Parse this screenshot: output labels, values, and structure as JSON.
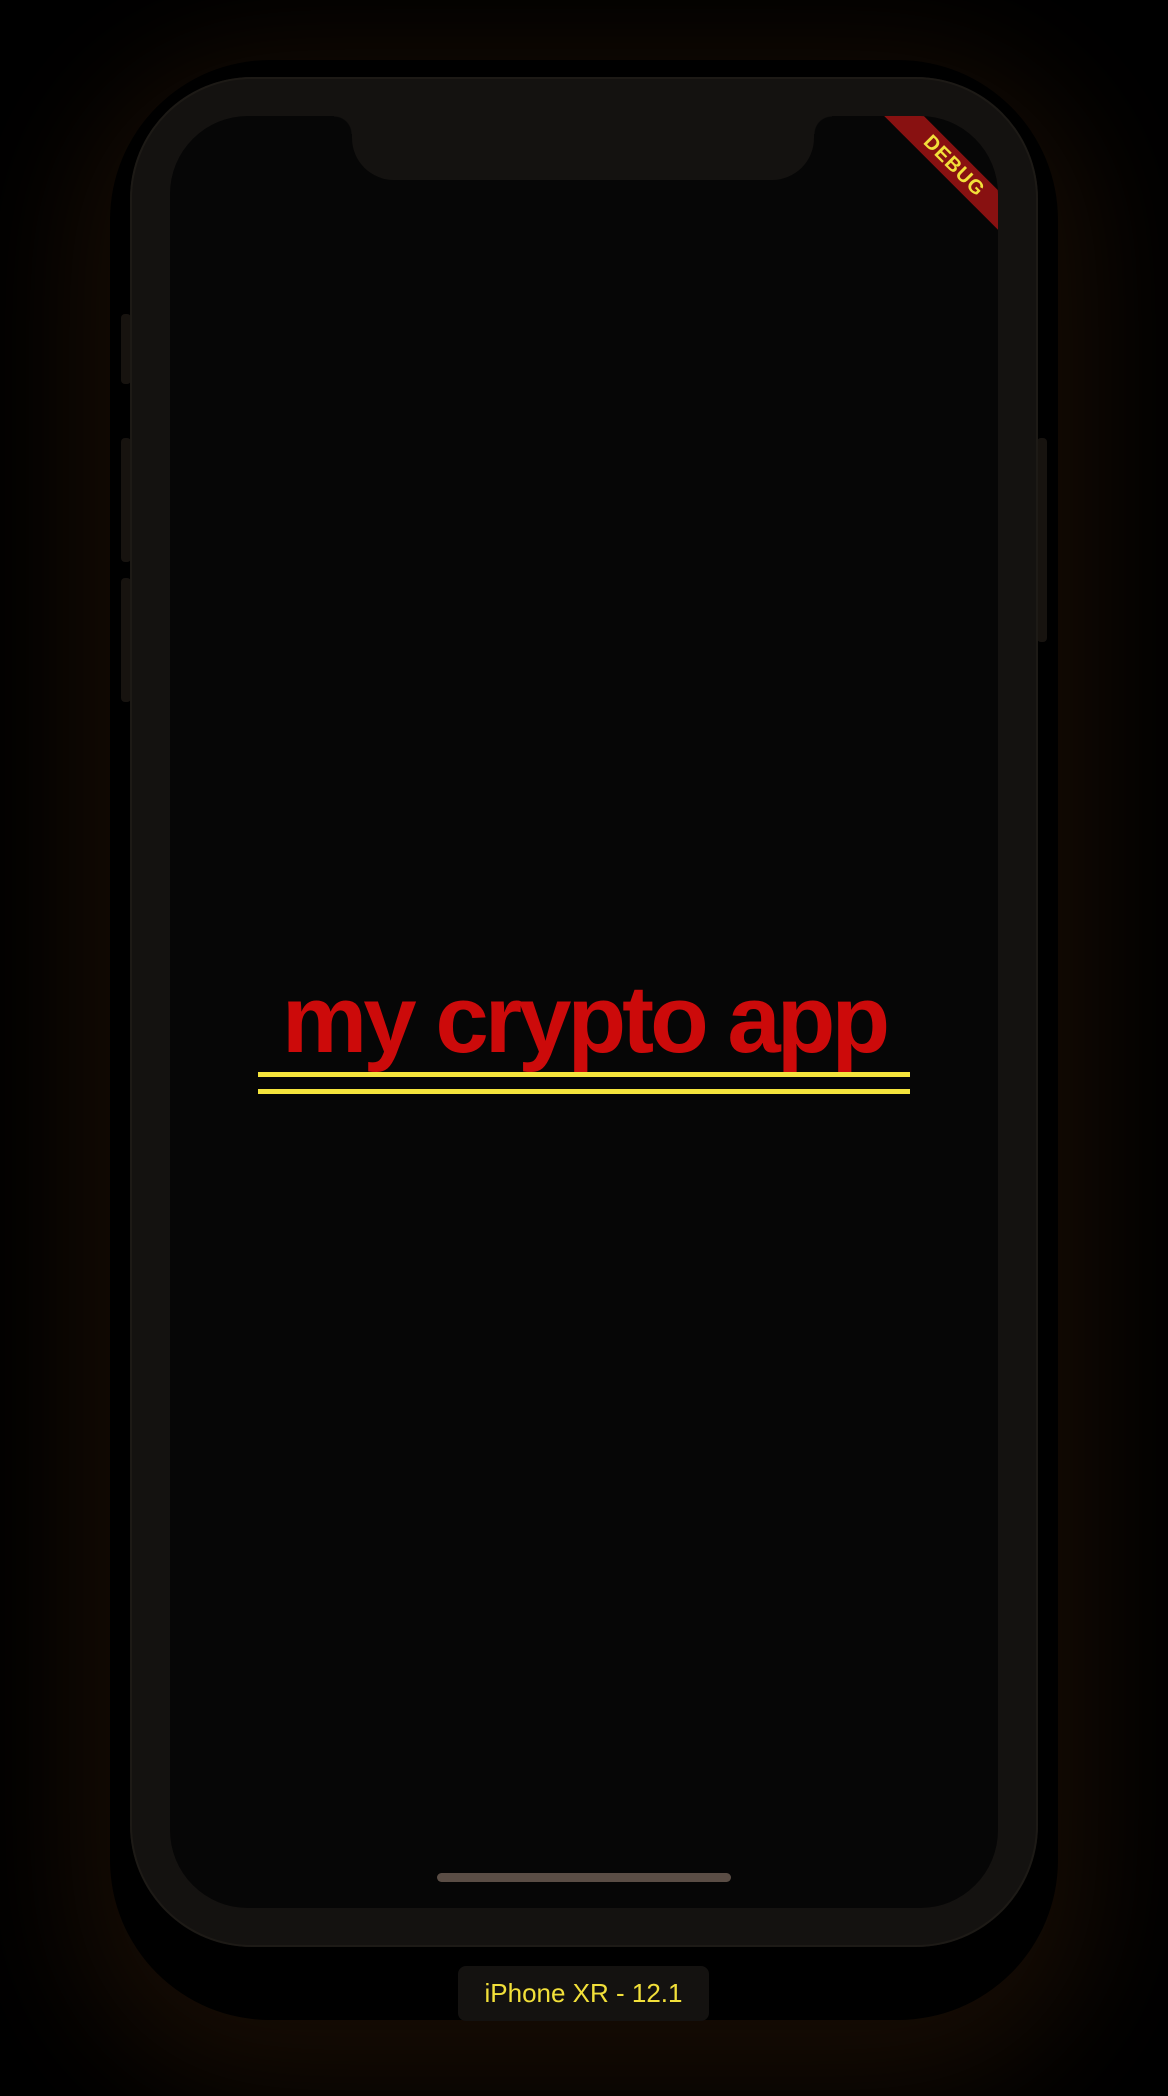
{
  "app": {
    "title": "my crypto app"
  },
  "debug_banner": {
    "label": "DEBUG"
  },
  "simulator": {
    "device_label": "iPhone XR - 12.1"
  },
  "colors": {
    "background": "#060606",
    "title": "#cc0a0a",
    "underline": "#f4e43c",
    "banner_bg": "#a01414",
    "banner_text": "#f2e03a",
    "device_label_text": "#f2e03a",
    "bezel": "#141210"
  }
}
